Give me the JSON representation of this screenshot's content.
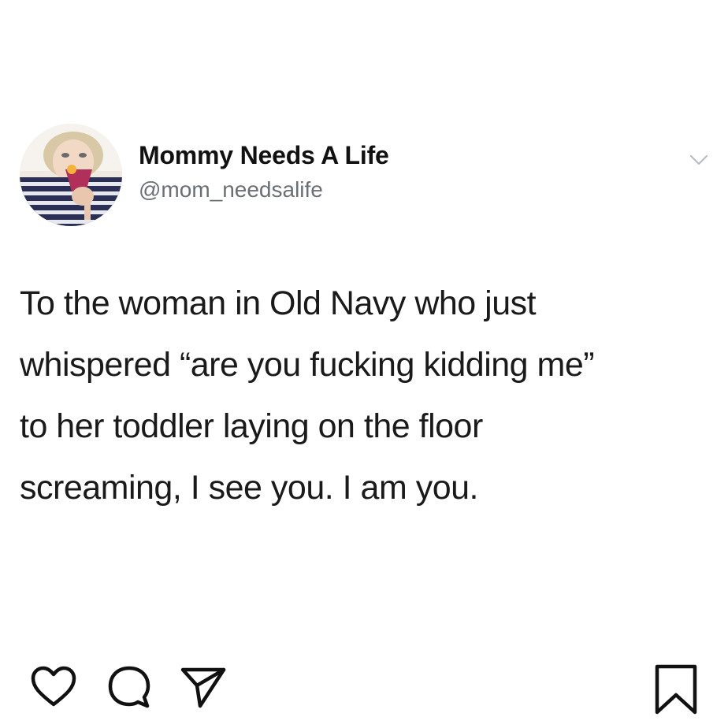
{
  "post": {
    "display_name": "Mommy Needs A Life",
    "handle": "@mom_needsalife",
    "text_lines": [
      "To the woman in Old Navy who just",
      "whispered “are you fucking kidding me”",
      "to her toddler laying on the floor",
      "screaming, I see you.  I am you."
    ]
  },
  "icons": {
    "menu": "chevron-down-icon",
    "like": "heart-icon",
    "comment": "comment-icon",
    "share": "paper-plane-icon",
    "save": "bookmark-icon"
  },
  "colors": {
    "text": "#1a1a1a",
    "handle": "#6b6f73",
    "icon": "#111111",
    "chevron": "#b8bcc2"
  }
}
